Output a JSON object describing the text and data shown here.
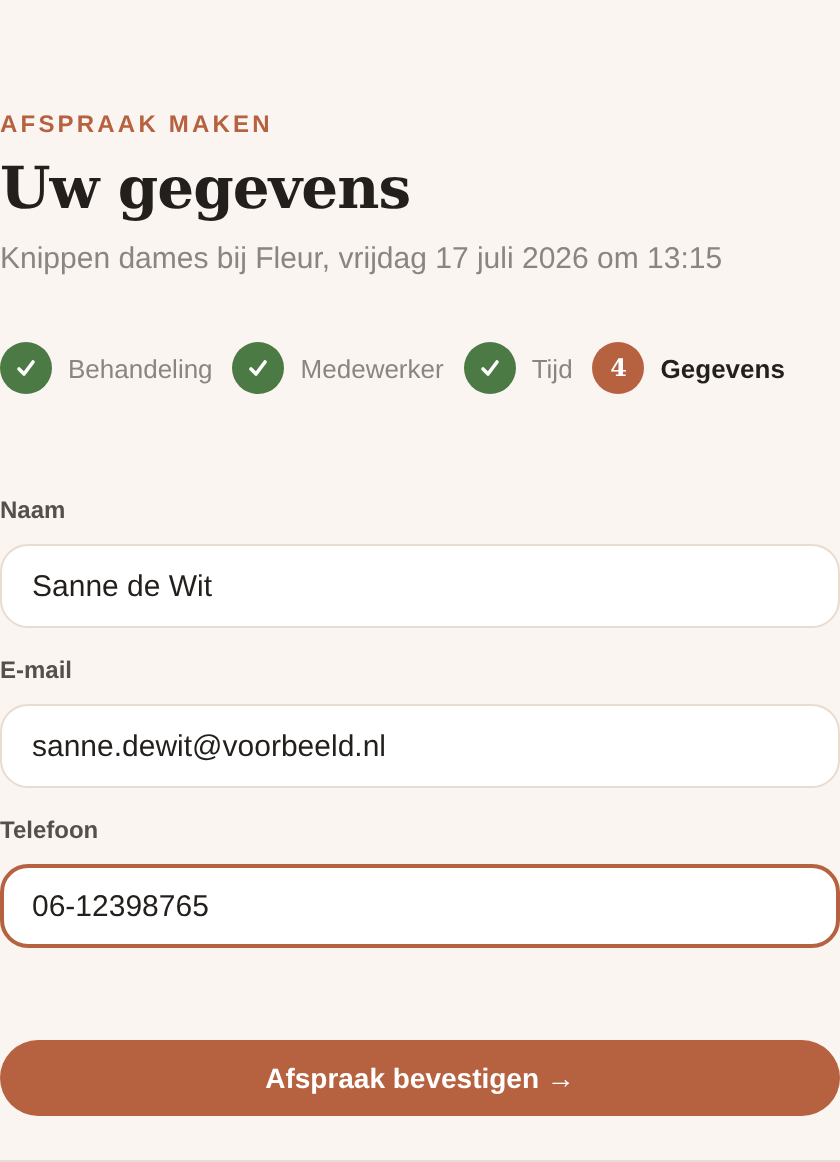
{
  "eyebrow": "AFSPRAAK MAKEN",
  "title": "Uw gegevens",
  "subtitle": "Knippen dames bij Fleur, vrijdag 17 juli 2026 om 13:15",
  "steps": [
    {
      "label": "Behandeling",
      "done": true,
      "current": false
    },
    {
      "label": "Medewerker",
      "done": true,
      "current": false
    },
    {
      "label": "Tijd",
      "done": true,
      "current": false
    },
    {
      "label": "Gegevens",
      "done": false,
      "current": true,
      "number": "4"
    }
  ],
  "fields": [
    {
      "label": "Naam",
      "value": "Sanne de Wit",
      "focused": false
    },
    {
      "label": "E-mail",
      "value": "sanne.dewit@voorbeeld.nl",
      "focused": false
    },
    {
      "label": "Telefoon",
      "value": "06-12398765",
      "focused": true
    }
  ],
  "submit": "Afspraak bevestigen →"
}
